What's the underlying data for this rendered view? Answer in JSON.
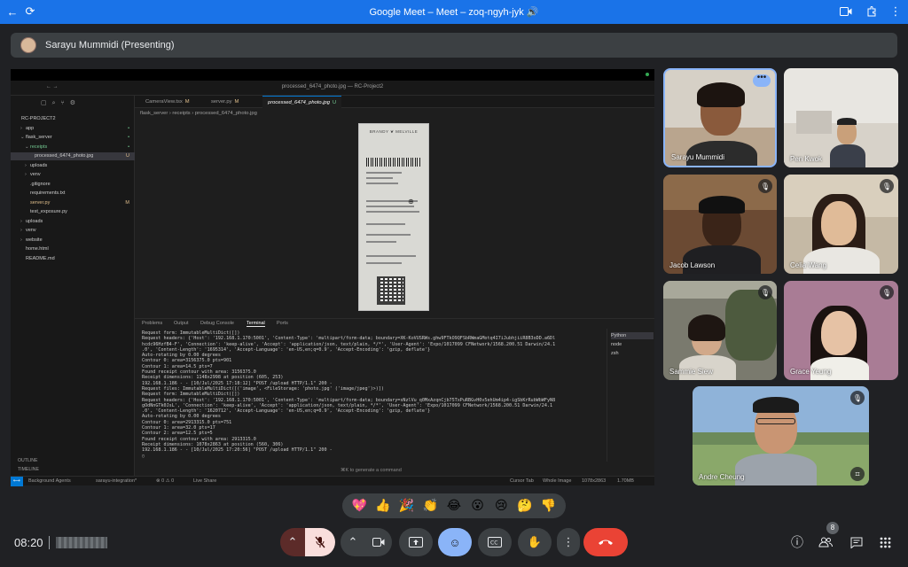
{
  "browser": {
    "title": "Google Meet – Meet – zoq-ngyh-jyk 🔊"
  },
  "presenting": {
    "name": "Sarayu Mummidi (Presenting)"
  },
  "editor": {
    "window_title": "processed_6474_photo.jpg — RC-Project2",
    "explorer": [
      {
        "label": "RC-PROJECT2",
        "indent": 0,
        "arrow": ""
      },
      {
        "label": "app",
        "indent": 1,
        "arrow": "›",
        "badge": "•"
      },
      {
        "label": "flask_server",
        "indent": 1,
        "arrow": "⌄",
        "badge": "•"
      },
      {
        "label": "receipts",
        "indent": 2,
        "arrow": "⌄",
        "badge": "•",
        "color": "#73c991"
      },
      {
        "label": "processed_6474_photo.jpg",
        "indent": 3,
        "arrow": "",
        "badge": "U",
        "selected": true
      },
      {
        "label": "uploads",
        "indent": 2,
        "arrow": "›"
      },
      {
        "label": "venv",
        "indent": 2,
        "arrow": "›"
      },
      {
        "label": ".gitignore",
        "indent": 2,
        "arrow": ""
      },
      {
        "label": "requirements.txt",
        "indent": 2,
        "arrow": ""
      },
      {
        "label": "server.py",
        "indent": 2,
        "arrow": "",
        "badge": "M",
        "color": "#e2c08d"
      },
      {
        "label": "test_exposure.py",
        "indent": 2,
        "arrow": ""
      },
      {
        "label": "uploads",
        "indent": 1,
        "arrow": "›"
      },
      {
        "label": "venv",
        "indent": 1,
        "arrow": "›"
      },
      {
        "label": "website",
        "indent": 1,
        "arrow": "›"
      },
      {
        "label": "home.html",
        "indent": 1,
        "arrow": ""
      },
      {
        "label": "README.md",
        "indent": 1,
        "arrow": ""
      }
    ],
    "outline_label": "OUTLINE",
    "timeline_label": "TIMELINE",
    "tabs": [
      {
        "label": "CameraView.tsx",
        "mark": "M"
      },
      {
        "label": "server.py",
        "mark": "M"
      },
      {
        "label": "processed_6474_photo.jpg",
        "mark": "U",
        "active": true
      }
    ],
    "breadcrumb": "flask_server › receipts › processed_6474_photo.jpg",
    "receipt_brand": "BRANDY ❦ MELVILLE",
    "panel_tabs": [
      "Problems",
      "Output",
      "Debug Console",
      "Terminal",
      "Ports"
    ],
    "active_panel": "Terminal",
    "terminal_lines": [
      "Request form: ImmutableMultiDict([])",
      "Request headers: {'Host': '192.168.1.170:5001', 'Content-Type': 'multipart/form-data; boundary=XK-KoVUSRWs.ghw9FTkO9QFSbRWmaGMotq4I7iJubhjiiR8B3oDD.a6Dl",
      "hcdc96HzfB4-F', 'Connection': 'keep-alive', 'Accept': 'application/json, text/plain, */*', 'User-Agent': 'Expo/1017099 CFNetwork/1568.200.51 Darwin/24.1",
      ".0', 'Content-Length': '1695314', 'Accept-Language': 'en-US,en;q=0.9', 'Accept-Encoding': 'gzip, deflate'}",
      "Auto-rotating by 0.00 degrees",
      "Contour 0: area=3156375.0 pts=901",
      "Contour 1: area=14.5 pts=7",
      "Found receipt contour with area: 3156375.0",
      "Receipt dimensions: 1148x2998 at position (605, 253)",
      "192.168.1.186 - - [10/Jul/2025 17:18:12] \"POST /upload HTTP/1.1\" 200 -",
      "Request files: ImmutableMultiDict([('image', <FileStorage: 'photo.jpg' ('image/jpeg')>)])",
      "Request form: ImmutableMultiDict([])",
      "Request headers: {'Host': '192.168.1.170:5001', 'Content-Type': 'multipart/form-data; boundary=sNzlVu_q0MxAzqnCjb75TxPuRBGvH0v5ehUm4ip4-igSbKrRubWbWFyN8",
      "gOdNnGTk0JsL', 'Connection': 'keep-alive', 'Accept': 'application/json, text/plain, */*', 'User-Agent': 'Expo/1017099 CFNetwork/1568.200.51 Darwin/24.1",
      ".0', 'Content-Length': '1620712', 'Accept-Language': 'en-US,en;q=0.9', 'Accept-Encoding': 'gzip, deflate'}",
      "Auto-rotating by 0.00 degrees",
      "Contour 0: area=2913315.0 pts=751",
      "Contour 1: area=32.0 pts=17",
      "Contour 2: area=12.5 pts=5",
      "Found receipt contour with area: 2913315.0",
      "Receipt dimensions: 1078x2863 at position (560, 306)",
      "192.168.1.186 - - [10/Jul/2025 17:20:56] \"POST /upload HTTP/1.1\" 200 -",
      "▯"
    ],
    "terminal_sessions": [
      "Python",
      "node",
      "zsh"
    ],
    "terminal_hint": "⌘K to generate a command",
    "status": {
      "agents": "Background Agents",
      "branch": "sarayu-integration*",
      "problems": "⊗ 0 ⚠ 0",
      "live": "Live Share",
      "cursor_tab": "Cursor Tab",
      "whole_image": "Whole Image",
      "dims": "1078x2863",
      "size": "1.70MB"
    }
  },
  "participants": [
    {
      "name": "Sarayu Mummidi",
      "muted": false,
      "active": true
    },
    {
      "name": "Pen Kwok",
      "muted": false
    },
    {
      "name": "Jacob Lawson",
      "muted": true
    },
    {
      "name": "Celia Wang",
      "muted": true
    },
    {
      "name": "Sammie Siew",
      "muted": true
    },
    {
      "name": "Grace Yeung",
      "muted": true
    },
    {
      "name": "Andre Cheung",
      "muted": true
    }
  ],
  "reactions": [
    "💖",
    "👍",
    "🎉",
    "👏",
    "😂",
    "😮",
    "😢",
    "🤔",
    "👎"
  ],
  "bottom": {
    "time": "08:20",
    "people_count": "8"
  },
  "colors": {
    "meet_blue": "#1a73e8",
    "bg": "#202124",
    "end_call": "#ea4335",
    "accent": "#8ab4f8"
  }
}
